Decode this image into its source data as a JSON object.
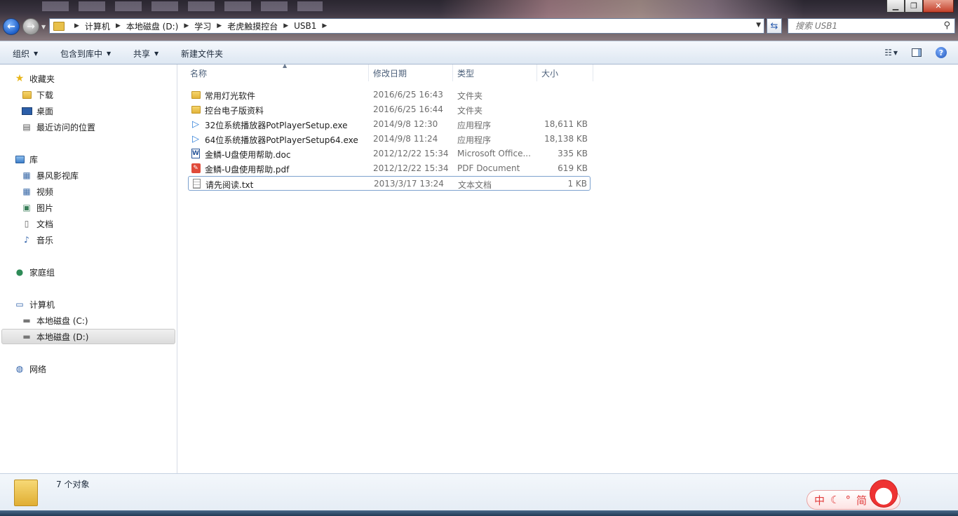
{
  "address": {
    "crumbs": [
      "计算机",
      "本地磁盘 (D:)",
      "学习",
      "老虎触摸控台",
      "USB1"
    ]
  },
  "search": {
    "placeholder": "搜索 USB1"
  },
  "commands": {
    "organize": "组织",
    "include_library": "包含到库中",
    "share": "共享",
    "new_folder": "新建文件夹"
  },
  "nav": {
    "favorites": "收藏夹",
    "downloads": "下载",
    "desktop": "桌面",
    "recent": "最近访问的位置",
    "libraries": "库",
    "storm": "暴风影视库",
    "videos": "视频",
    "pictures": "图片",
    "documents": "文档",
    "music": "音乐",
    "homegroup": "家庭组",
    "computer": "计算机",
    "drive_c": "本地磁盘 (C:)",
    "drive_d": "本地磁盘 (D:)",
    "network": "网络"
  },
  "columns": {
    "name": "名称",
    "modified": "修改日期",
    "type": "类型",
    "size": "大小"
  },
  "files": [
    {
      "name": "常用灯光软件",
      "date": "2016/6/25 16:43",
      "type": "文件夹",
      "size": "",
      "icon": "folder-icon"
    },
    {
      "name": "控台电子版资料",
      "date": "2016/6/25 16:44",
      "type": "文件夹",
      "size": "",
      "icon": "folder-icon"
    },
    {
      "name": "32位系统播放器PotPlayerSetup.exe",
      "date": "2014/9/8 12:30",
      "type": "应用程序",
      "size": "18,611 KB",
      "icon": "exe-icon"
    },
    {
      "name": "64位系统播放器PotPlayerSetup64.exe",
      "date": "2014/9/8 11:24",
      "type": "应用程序",
      "size": "18,138 KB",
      "icon": "exe-icon"
    },
    {
      "name": "金鳞-U盘使用帮助.doc",
      "date": "2012/12/22 15:34",
      "type": "Microsoft Office...",
      "size": "335 KB",
      "icon": "word-doc-icon"
    },
    {
      "name": "金鳞-U盘使用帮助.pdf",
      "date": "2012/12/22 15:34",
      "type": "PDF Document",
      "size": "619 KB",
      "icon": "pdf-icon"
    },
    {
      "name": "请先阅读.txt",
      "date": "2013/3/17 13:24",
      "type": "文本文档",
      "size": "1 KB",
      "icon": "text-file-icon"
    }
  ],
  "details": {
    "count": "7 个对象"
  },
  "ime": {
    "mode": "中",
    "punct": "°",
    "simplified": "简"
  }
}
